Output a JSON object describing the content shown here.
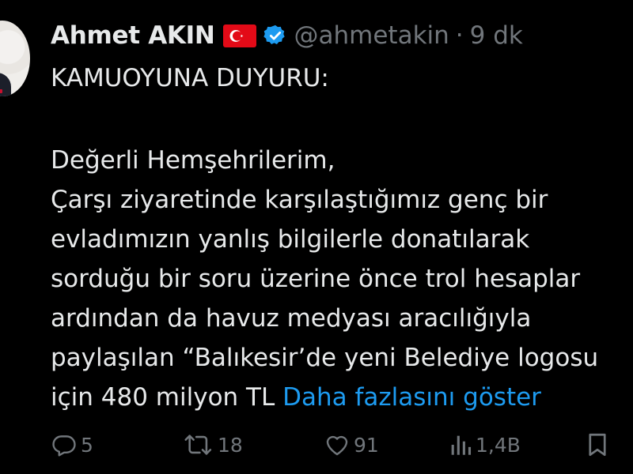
{
  "author": {
    "name": "Ahmet AKIN",
    "handle": "@ahmetakin",
    "separator": "·",
    "time": "9 dk",
    "flag_icon": "turkey-flag-icon",
    "verified_icon": "verified-badge-icon"
  },
  "tweet": {
    "lines": [
      "KAMUOYUNA DUYURU:",
      "Değerli Hemşehrilerim,",
      "Çarşı ziyaretinde karşılaştığımız genç bir",
      "evladımızın yanlış bilgilerle donatılarak",
      "sorduğu bir soru üzerine önce trol hesaplar",
      "ardından da havuz medyası aracılığıyla",
      "paylaşılan “Balıkesir’de yeni Belediye logosu",
      "için 480 milyon TL"
    ],
    "show_more": "Daha fazlasını göster"
  },
  "actions": {
    "replies": "5",
    "reposts": "18",
    "likes": "91",
    "views": "1,4B"
  },
  "colors": {
    "background": "#000000",
    "text": "#e7e9ea",
    "muted": "#71767b",
    "link": "#1d9bf0",
    "verified": "#1d9bf0",
    "flag_red": "#e30a17"
  }
}
